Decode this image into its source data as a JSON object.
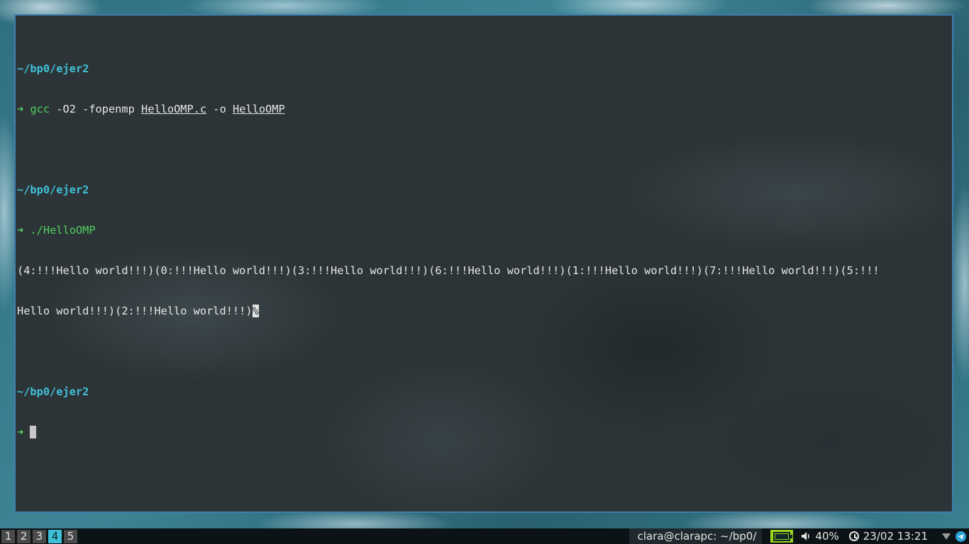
{
  "terminal": {
    "prompt_dir": "~/bp0/ejer2",
    "prompt_arrow": "➜",
    "cmd1": {
      "program": "gcc",
      "opt1": "-O2 -fopenmp",
      "source_file": "HelloOMP.c",
      "opt2": "-o",
      "output_file": "HelloOMP"
    },
    "cmd2": {
      "program": "./HelloOMP"
    },
    "output_line1": "(4:!!!Hello world!!!)(0:!!!Hello world!!!)(3:!!!Hello world!!!)(6:!!!Hello world!!!)(1:!!!Hello world!!!)(7:!!!Hello world!!!)(5:!!!",
    "output_line2": "Hello world!!!)(2:!!!Hello world!!!)",
    "no_newline_marker": "%"
  },
  "taskbar": {
    "workspaces": [
      "1",
      "2",
      "3",
      "4",
      "5"
    ],
    "active_workspace": "4",
    "window_title": "clara@clarapc: ~/bp0/",
    "volume": "40%",
    "datetime": "23/02 13:21",
    "icons": {
      "battery": "battery-icon",
      "volume": "speaker-icon",
      "clock": "clock-icon",
      "wifi": "wifi-icon",
      "telegram": "telegram-icon"
    },
    "colors": {
      "accent": "#3fc0d8",
      "battery": "#9ad21a",
      "prompt_dir": "#3fc0d8",
      "prompt_cmd": "#4fd060"
    }
  }
}
